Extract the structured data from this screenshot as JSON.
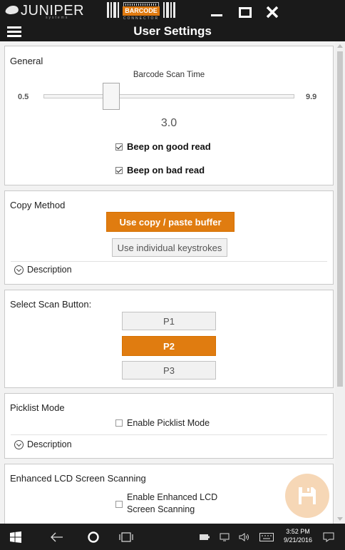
{
  "titlebar": {
    "brand": "JUNIPER",
    "brand_sub": "systems",
    "product": "BARCODE",
    "product_sub": "CONNECTOR",
    "minimize_icon": "minimize-icon",
    "maximize_icon": "maximize-icon",
    "close_icon": "close-icon"
  },
  "header": {
    "menu_icon": "hamburger-menu-icon",
    "title": "User Settings"
  },
  "general": {
    "title": "General",
    "slider": {
      "label": "Barcode Scan Time",
      "min": "0.5",
      "max": "9.9",
      "value": "3.0",
      "fraction": 0.27
    },
    "beep_good": {
      "label": "Beep on good read",
      "checked": true
    },
    "beep_bad": {
      "label": "Beep on bad read",
      "checked": true
    }
  },
  "copy_method": {
    "title": "Copy Method",
    "options": [
      "Use copy / paste buffer",
      "Use individual keystrokes"
    ],
    "selected": "Use copy / paste buffer",
    "description_label": "Description"
  },
  "scan_button": {
    "title": "Select Scan Button:",
    "options": [
      "P1",
      "P2",
      "P3"
    ],
    "selected": "P2"
  },
  "picklist": {
    "title": "Picklist Mode",
    "checkbox_label": "Enable Picklist Mode",
    "checked": false,
    "description_label": "Description"
  },
  "enhanced_lcd": {
    "title": "Enhanced LCD Screen Scanning",
    "checkbox_line1": "Enable Enhanced LCD",
    "checkbox_line2": "Screen Scanning",
    "checked": false
  },
  "fab": {
    "icon": "save-floppy-icon"
  },
  "taskbar": {
    "time": "3:52 PM",
    "date": "9/21/2016"
  },
  "colors": {
    "accent": "#e07c10",
    "titlebar": "#1a1a1a",
    "fab": "#f6d7b6"
  }
}
